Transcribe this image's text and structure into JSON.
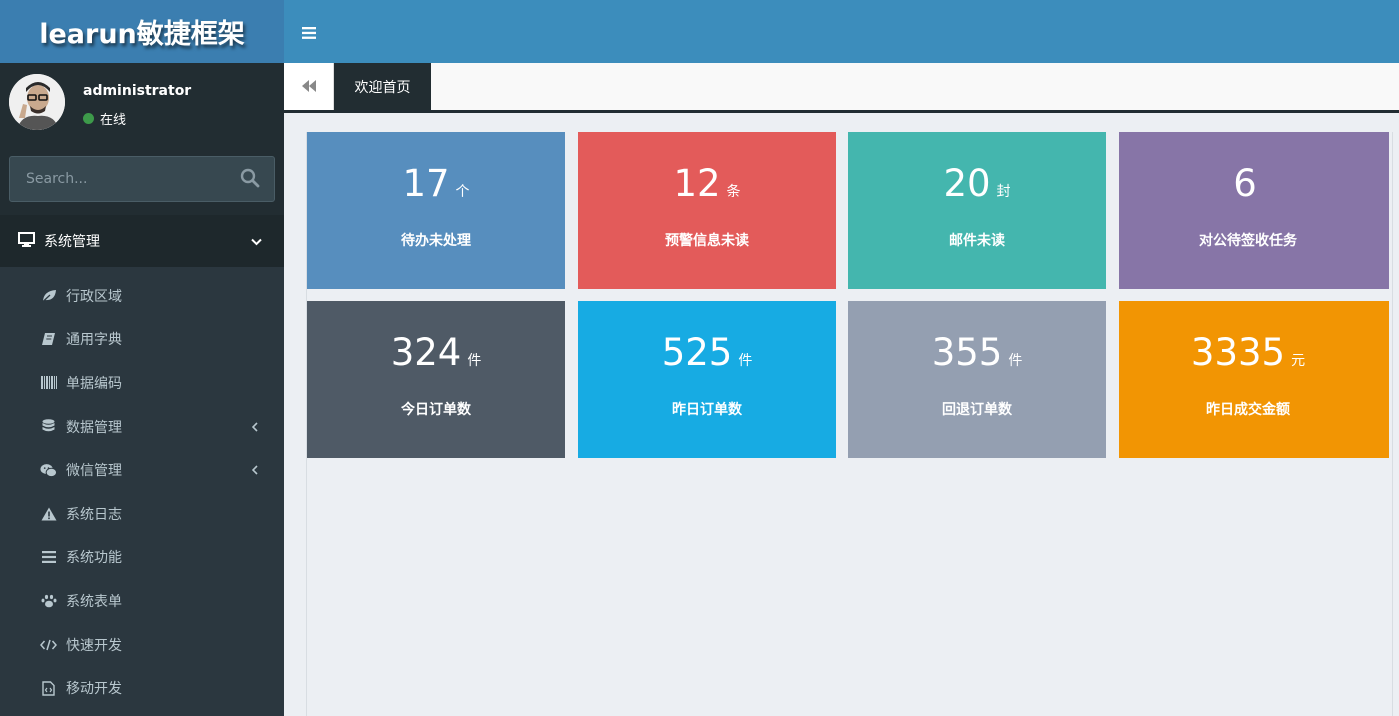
{
  "app": {
    "logo_text": "learun敏捷框架"
  },
  "user": {
    "name": "administrator",
    "status": "在线"
  },
  "search": {
    "placeholder": "Search..."
  },
  "menu": {
    "header": "系统管理",
    "items": [
      {
        "label": "行政区域",
        "icon": "leaf-icon",
        "has_children": false
      },
      {
        "label": "通用字典",
        "icon": "book-icon",
        "has_children": false
      },
      {
        "label": "单据编码",
        "icon": "barcode-icon",
        "has_children": false
      },
      {
        "label": "数据管理",
        "icon": "database-icon",
        "has_children": true
      },
      {
        "label": "微信管理",
        "icon": "wechat-icon",
        "has_children": true
      },
      {
        "label": "系统日志",
        "icon": "warning-icon",
        "has_children": false
      },
      {
        "label": "系统功能",
        "icon": "list-icon",
        "has_children": false
      },
      {
        "label": "系统表单",
        "icon": "paw-icon",
        "has_children": false
      },
      {
        "label": "快速开发",
        "icon": "code-icon",
        "has_children": false
      },
      {
        "label": "移动开发",
        "icon": "file-code-icon",
        "has_children": false
      }
    ]
  },
  "tabs": {
    "active": "欢迎首页"
  },
  "cards": [
    {
      "value": "17",
      "unit": "个",
      "label": "待办未处理",
      "color": "#578ebe"
    },
    {
      "value": "12",
      "unit": "条",
      "label": "预警信息未读",
      "color": "#e35b5a"
    },
    {
      "value": "20",
      "unit": "封",
      "label": "邮件未读",
      "color": "#44b6ae"
    },
    {
      "value": "6",
      "unit": "",
      "label": "对公待签收任务",
      "color": "#8775a7"
    },
    {
      "value": "324",
      "unit": "件",
      "label": "今日订单数",
      "color": "#4f5a66"
    },
    {
      "value": "525",
      "unit": "件",
      "label": "昨日订单数",
      "color": "#17abe3"
    },
    {
      "value": "355",
      "unit": "件",
      "label": "回退订单数",
      "color": "#949fb1"
    },
    {
      "value": "3335",
      "unit": "元",
      "label": "昨日成交金额",
      "color": "#f29503"
    }
  ],
  "colors": {
    "header": "#3c8dbc",
    "logo_bg": "#3b7eb0",
    "sidebar": "#2b373f",
    "sidebar_dark": "#222d32"
  }
}
